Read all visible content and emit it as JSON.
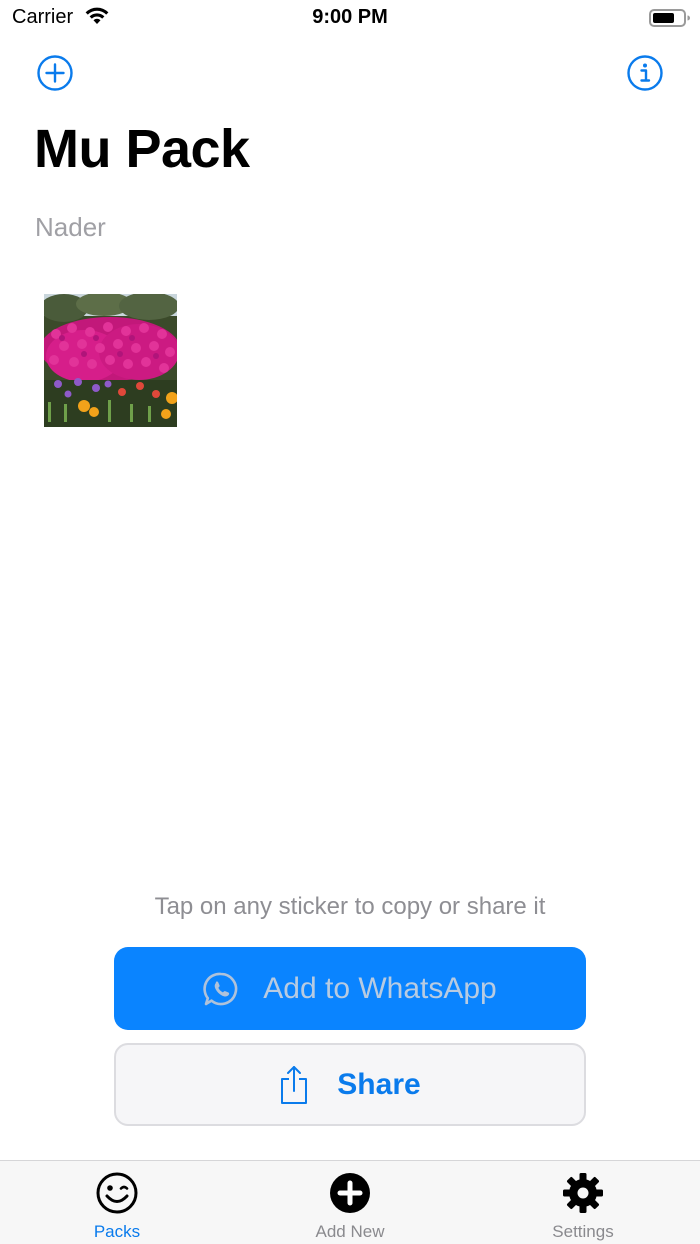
{
  "status_bar": {
    "carrier": "Carrier",
    "time": "9:00 PM"
  },
  "nav": {
    "left_icon": "plus-circle-icon",
    "right_icon": "info-circle-icon"
  },
  "pack": {
    "title": "Mu Pack",
    "author": "Nader",
    "stickers": [
      {
        "description_icon": "flowers-sticker"
      }
    ]
  },
  "hint": "Tap on any sticker to copy or share it",
  "buttons": {
    "whatsapp_label": "Add to WhatsApp",
    "share_label": "Share"
  },
  "tabs": [
    {
      "label": "Packs",
      "icon": "smiley-icon",
      "active": true
    },
    {
      "label": "Add New",
      "icon": "plus-circle-filled-icon",
      "active": false
    },
    {
      "label": "Settings",
      "icon": "gear-icon",
      "active": false
    }
  ],
  "colors": {
    "accent": "#0a84ff",
    "tab_active": "#0a7bec",
    "tab_inactive": "#8a8a8e",
    "secondary_text": "#a0a0a5"
  }
}
